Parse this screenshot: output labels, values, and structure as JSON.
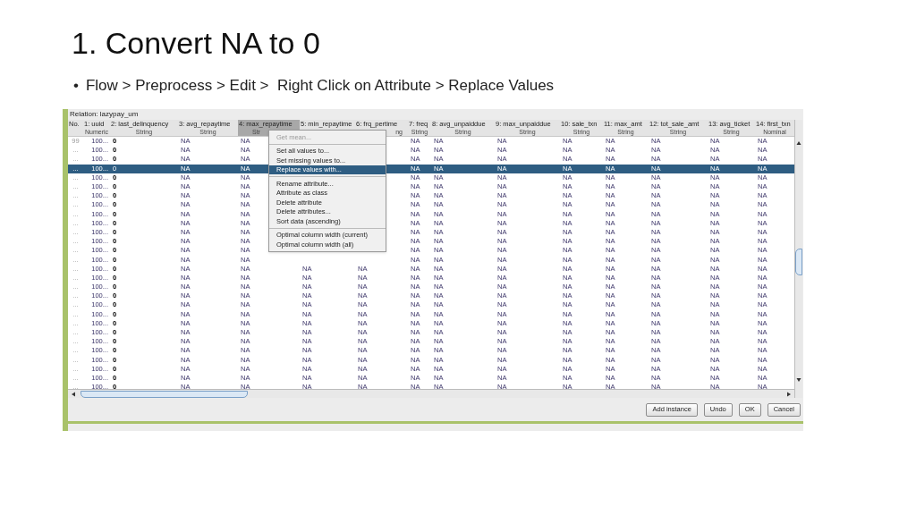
{
  "slide": {
    "title": "1. Convert NA to 0",
    "marker": "•",
    "bullet": "Flow > Preprocess > Edit >  Right Click on Attribute > Replace Values"
  },
  "relation": "Relation: lazypay_um",
  "table": {
    "columns": [
      {
        "name": "No.",
        "kind": "index"
      },
      {
        "name": "1: uuid",
        "type": "Numeric",
        "kind": "numeric"
      },
      {
        "name": "2: last_delinquency",
        "type": "String",
        "kind": "string"
      },
      {
        "name": "3: avg_repaytime",
        "type": "String",
        "kind": "string"
      },
      {
        "name": "4: max_repaytime",
        "type": "Str",
        "kind": "string",
        "selected": true
      },
      {
        "name": "5: min_repaytime",
        "kind": "string",
        "selected": false
      },
      {
        "name": "6: frq_pertime",
        "type": "ng",
        "kind": "string"
      },
      {
        "name": "7: freq",
        "type": "String",
        "kind": "string"
      },
      {
        "name": "8: avg_unpaiddue",
        "type": "String",
        "kind": "string"
      },
      {
        "name": "9: max_unpaiddue",
        "type": "String",
        "kind": "string"
      },
      {
        "name": "10: sale_txn",
        "type": "String",
        "kind": "string"
      },
      {
        "name": "11: max_amt",
        "type": "String",
        "kind": "string"
      },
      {
        "name": "12: tot_sale_amt",
        "type": "String",
        "kind": "string"
      },
      {
        "name": "13: avg_ticket",
        "type": "String",
        "kind": "string"
      },
      {
        "name": "14: first_txn",
        "type": "Nominal",
        "kind": "string"
      }
    ],
    "rows": [
      {
        "selected": false,
        "cells": [
          "99",
          "100...",
          "0",
          "NA",
          "NA",
          null,
          null,
          "NA",
          "NA",
          "NA",
          "NA",
          "NA",
          "NA",
          "NA",
          "NA"
        ]
      },
      {
        "selected": false,
        "cells": [
          "...",
          "100...",
          "0",
          "NA",
          "NA",
          null,
          null,
          "NA",
          "NA",
          "NA",
          "NA",
          "NA",
          "NA",
          "NA",
          "NA"
        ]
      },
      {
        "selected": false,
        "cells": [
          "...",
          "100...",
          "0",
          "NA",
          "NA",
          null,
          null,
          "NA",
          "NA",
          "NA",
          "NA",
          "NA",
          "NA",
          "NA",
          "NA"
        ]
      },
      {
        "selected": true,
        "cells": [
          "...",
          "100...",
          "0",
          "NA",
          "NA",
          null,
          null,
          "NA",
          "NA",
          "NA",
          "NA",
          "NA",
          "NA",
          "NA",
          "NA"
        ]
      },
      {
        "selected": false,
        "cells": [
          "...",
          "100...",
          "0",
          "NA",
          "NA",
          null,
          null,
          "NA",
          "NA",
          "NA",
          "NA",
          "NA",
          "NA",
          "NA",
          "NA"
        ]
      },
      {
        "selected": false,
        "cells": [
          "...",
          "100...",
          "0",
          "NA",
          "NA",
          null,
          null,
          "NA",
          "NA",
          "NA",
          "NA",
          "NA",
          "NA",
          "NA",
          "NA"
        ]
      },
      {
        "selected": false,
        "cells": [
          "...",
          "100...",
          "0",
          "NA",
          "NA",
          null,
          null,
          "NA",
          "NA",
          "NA",
          "NA",
          "NA",
          "NA",
          "NA",
          "NA"
        ]
      },
      {
        "selected": false,
        "cells": [
          "...",
          "100...",
          "0",
          "NA",
          "NA",
          null,
          null,
          "NA",
          "NA",
          "NA",
          "NA",
          "NA",
          "NA",
          "NA",
          "NA"
        ]
      },
      {
        "selected": false,
        "cells": [
          "...",
          "100...",
          "0",
          "NA",
          "NA",
          null,
          null,
          "NA",
          "NA",
          "NA",
          "NA",
          "NA",
          "NA",
          "NA",
          "NA"
        ]
      },
      {
        "selected": false,
        "cells": [
          "...",
          "100...",
          "0",
          "NA",
          "NA",
          null,
          null,
          "NA",
          "NA",
          "NA",
          "NA",
          "NA",
          "NA",
          "NA",
          "NA"
        ]
      },
      {
        "selected": false,
        "cells": [
          "...",
          "100...",
          "0",
          "NA",
          "NA",
          null,
          null,
          "NA",
          "NA",
          "NA",
          "NA",
          "NA",
          "NA",
          "NA",
          "NA"
        ]
      },
      {
        "selected": false,
        "cells": [
          "...",
          "100...",
          "0",
          "NA",
          "NA",
          null,
          null,
          "NA",
          "NA",
          "NA",
          "NA",
          "NA",
          "NA",
          "NA",
          "NA"
        ]
      },
      {
        "selected": false,
        "cells": [
          "...",
          "100...",
          "0",
          "NA",
          "NA",
          null,
          null,
          "NA",
          "NA",
          "NA",
          "NA",
          "NA",
          "NA",
          "NA",
          "NA"
        ]
      },
      {
        "selected": false,
        "cells": [
          "...",
          "100...",
          "0",
          "NA",
          "NA",
          null,
          null,
          "NA",
          "NA",
          "NA",
          "NA",
          "NA",
          "NA",
          "NA",
          "NA"
        ]
      },
      {
        "selected": false,
        "cells": [
          "...",
          "100...",
          "0",
          "NA",
          "NA",
          "NA",
          "NA",
          "NA",
          "NA",
          "NA",
          "NA",
          "NA",
          "NA",
          "NA",
          "NA"
        ]
      },
      {
        "selected": false,
        "cells": [
          "...",
          "100...",
          "0",
          "NA",
          "NA",
          "NA",
          "NA",
          "NA",
          "NA",
          "NA",
          "NA",
          "NA",
          "NA",
          "NA",
          "NA"
        ]
      },
      {
        "selected": false,
        "cells": [
          "...",
          "100...",
          "0",
          "NA",
          "NA",
          "NA",
          "NA",
          "NA",
          "NA",
          "NA",
          "NA",
          "NA",
          "NA",
          "NA",
          "NA"
        ]
      },
      {
        "selected": false,
        "cells": [
          "...",
          "100...",
          "0",
          "NA",
          "NA",
          "NA",
          "NA",
          "NA",
          "NA",
          "NA",
          "NA",
          "NA",
          "NA",
          "NA",
          "NA"
        ]
      },
      {
        "selected": false,
        "cells": [
          "...",
          "100...",
          "0",
          "NA",
          "NA",
          "NA",
          "NA",
          "NA",
          "NA",
          "NA",
          "NA",
          "NA",
          "NA",
          "NA",
          "NA"
        ]
      },
      {
        "selected": false,
        "cells": [
          "...",
          "100...",
          "0",
          "NA",
          "NA",
          "NA",
          "NA",
          "NA",
          "NA",
          "NA",
          "NA",
          "NA",
          "NA",
          "NA",
          "NA"
        ]
      },
      {
        "selected": false,
        "cells": [
          "...",
          "100...",
          "0",
          "NA",
          "NA",
          "NA",
          "NA",
          "NA",
          "NA",
          "NA",
          "NA",
          "NA",
          "NA",
          "NA",
          "NA"
        ]
      },
      {
        "selected": false,
        "cells": [
          "...",
          "100...",
          "0",
          "NA",
          "NA",
          "NA",
          "NA",
          "NA",
          "NA",
          "NA",
          "NA",
          "NA",
          "NA",
          "NA",
          "NA"
        ]
      },
      {
        "selected": false,
        "cells": [
          "...",
          "100...",
          "0",
          "NA",
          "NA",
          "NA",
          "NA",
          "NA",
          "NA",
          "NA",
          "NA",
          "NA",
          "NA",
          "NA",
          "NA"
        ]
      },
      {
        "selected": false,
        "cells": [
          "...",
          "100...",
          "0",
          "NA",
          "NA",
          "NA",
          "NA",
          "NA",
          "NA",
          "NA",
          "NA",
          "NA",
          "NA",
          "NA",
          "NA"
        ]
      },
      {
        "selected": false,
        "cells": [
          "...",
          "100...",
          "0",
          "NA",
          "NA",
          "NA",
          "NA",
          "NA",
          "NA",
          "NA",
          "NA",
          "NA",
          "NA",
          "NA",
          "NA"
        ]
      },
      {
        "selected": false,
        "cells": [
          "...",
          "100...",
          "0",
          "NA",
          "NA",
          "NA",
          "NA",
          "NA",
          "NA",
          "NA",
          "NA",
          "NA",
          "NA",
          "NA",
          "NA"
        ]
      },
      {
        "selected": false,
        "cells": [
          "...",
          "100...",
          "0",
          "NA",
          "NA",
          "NA",
          "NA",
          "NA",
          "NA",
          "NA",
          "NA",
          "NA",
          "NA",
          "NA",
          "NA"
        ]
      },
      {
        "selected": false,
        "cells": [
          "...",
          "100...",
          "0",
          "NA",
          "NA",
          "NA",
          "NA",
          "NA",
          "NA",
          "NA",
          "NA",
          "NA",
          "NA",
          "NA",
          "NA"
        ]
      }
    ]
  },
  "context_menu": {
    "items": [
      {
        "kind": "item",
        "label": "Get mean...",
        "disabled": true,
        "selected": false
      },
      {
        "kind": "separator"
      },
      {
        "kind": "item",
        "label": "Set all values to...",
        "disabled": false,
        "selected": false
      },
      {
        "kind": "item",
        "label": "Set missing values to...",
        "disabled": false,
        "selected": false
      },
      {
        "kind": "item",
        "label": "Replace values with...",
        "disabled": false,
        "selected": true
      },
      {
        "kind": "separator"
      },
      {
        "kind": "item",
        "label": "Rename attribute...",
        "disabled": false,
        "selected": false
      },
      {
        "kind": "item",
        "label": "Attribute as class",
        "disabled": false,
        "selected": false
      },
      {
        "kind": "item",
        "label": "Delete attribute",
        "disabled": false,
        "selected": false
      },
      {
        "kind": "item",
        "label": "Delete attributes...",
        "disabled": false,
        "selected": false
      },
      {
        "kind": "item",
        "label": "Sort data (ascending)",
        "disabled": false,
        "selected": false
      },
      {
        "kind": "separator"
      },
      {
        "kind": "item",
        "label": "Optimal column width (current)",
        "disabled": false,
        "selected": false
      },
      {
        "kind": "item",
        "label": "Optimal column width (all)",
        "disabled": false,
        "selected": false
      }
    ]
  },
  "buttons": [
    "Add instance",
    "Undo",
    "OK",
    "Cancel"
  ]
}
